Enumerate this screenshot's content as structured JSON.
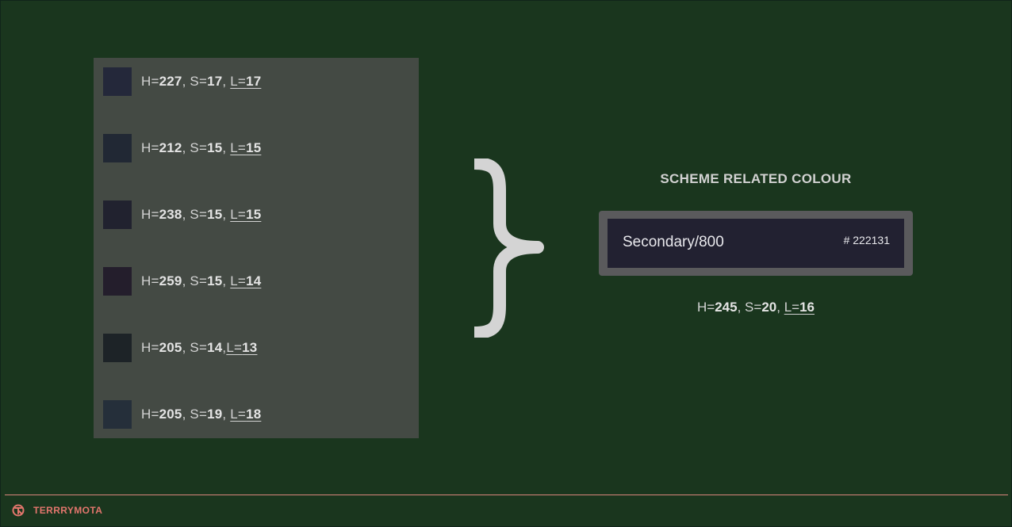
{
  "swatches": [
    {
      "color": "#24283a",
      "h_label": "H=",
      "h": "227",
      "s_label": ", S=",
      "s": "17",
      "sep": ", ",
      "l_label": "L=",
      "l": "17"
    },
    {
      "color": "#212834",
      "h_label": "H=",
      "h": "212",
      "s_label": ", S=",
      "s": "15",
      "sep": ", ",
      "l_label": "L=",
      "l": "15"
    },
    {
      "color": "#21222f",
      "h_label": "H=",
      "h": "238",
      "s_label": ", S=",
      "s": "15",
      "sep": ", ",
      "l_label": "L=",
      "l": "15"
    },
    {
      "color": "#241e2c",
      "h_label": "H=",
      "h": "259",
      "s_label": ", S=",
      "s": "15",
      "sep": ", ",
      "l_label": "L=",
      "l": "14"
    },
    {
      "color": "#1d2327",
      "h_label": "H=",
      "h": "205",
      "s_label": ", S=",
      "s": "14",
      "sep": ",",
      "l_label": "L=",
      "l": "13"
    },
    {
      "color": "#252f3a",
      "h_label": "H=",
      "h": "205",
      "s_label": ", S=",
      "s": "19",
      "sep": ", ",
      "l_label": "L=",
      "l": "18"
    }
  ],
  "scheme": {
    "title": "SCHEME RELATED COLOUR",
    "name": "Secondary/800",
    "hex": "# 222131",
    "color": "#222131",
    "h_label": "H=",
    "h": "245",
    "s_label": ", S=",
    "s": "20",
    "sep": ", ",
    "l_label": "L=",
    "l": "16"
  },
  "footer": {
    "brand": "TERRRYMOTA",
    "accent": "#e3766d"
  }
}
